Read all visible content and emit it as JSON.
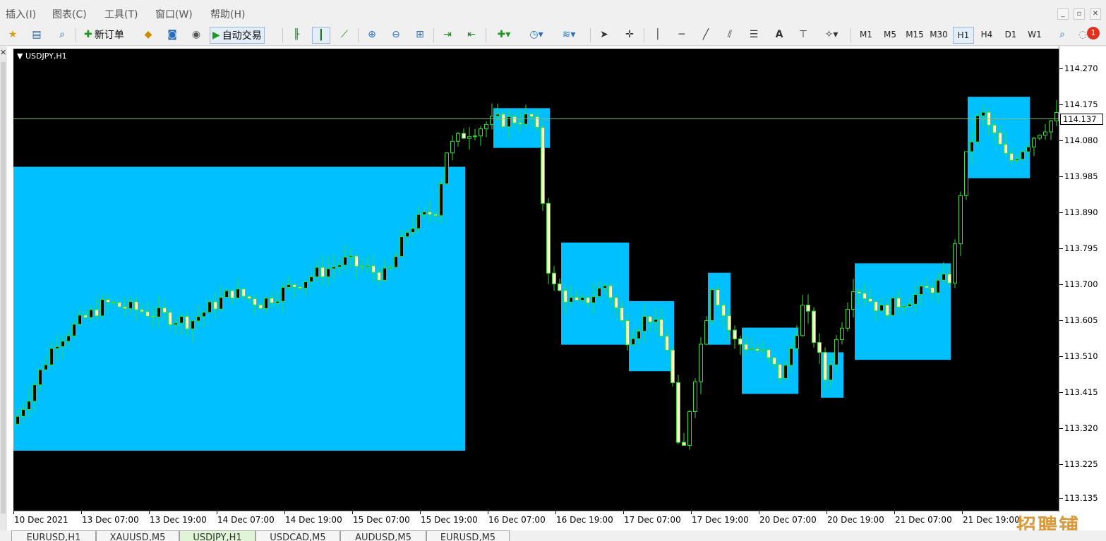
{
  "menu": {
    "items": [
      "插入(I)",
      "图表(C)",
      "工具(T)",
      "窗口(W)",
      "帮助(H)"
    ],
    "window_controls": [
      "_",
      "▫",
      "✕"
    ]
  },
  "toolbar": {
    "new_order_label": "新订单",
    "auto_trade_label": "自动交易",
    "text_tool_label": "A",
    "timeframes": [
      "M1",
      "M5",
      "M15",
      "M30",
      "H1",
      "H4",
      "D1",
      "W1"
    ],
    "active_timeframe": "H1",
    "notification_count": "1"
  },
  "chart": {
    "symbol_label": "USDJPY,H1",
    "current_price": "114.137",
    "price_ticks": [
      "114.270",
      "114.175",
      "114.080",
      "113.985",
      "113.890",
      "113.795",
      "113.700",
      "113.605",
      "113.510",
      "113.415",
      "113.320",
      "113.225",
      "113.135"
    ],
    "time_ticks": [
      "10 Dec 2021",
      "13 Dec 07:00",
      "13 Dec 19:00",
      "14 Dec 07:00",
      "14 Dec 19:00",
      "15 Dec 07:00",
      "15 Dec 19:00",
      "16 Dec 07:00",
      "16 Dec 19:00",
      "17 Dec 07:00",
      "17 Dec 19:00",
      "20 Dec 07:00",
      "20 Dec 19:00",
      "21 Dec 07:00",
      "21 Dec 19:00"
    ],
    "colors": {
      "background": "#000000",
      "bull_candle": "#000000",
      "bear_candle": "#ffffcc",
      "wick": "#33dd33",
      "box_fill": "#00c0ff",
      "price_line": "#7fbf7f"
    }
  },
  "chart_data": {
    "type": "candlestick",
    "title": "USDJPY,H1",
    "ylim": [
      113.135,
      114.27
    ],
    "current_price": 114.137,
    "range_boxes": [
      {
        "from": "10 Dec 2021",
        "to": "15 Dec 19:00",
        "high": 114.01,
        "low": 113.26
      },
      {
        "from": "16 Dec 00:00",
        "to": "16 Dec 10:00",
        "high": 114.165,
        "low": 114.06
      },
      {
        "from": "16 Dec 12:00",
        "to": "17 Dec 00:00",
        "high": 113.81,
        "low": 113.54
      },
      {
        "from": "17 Dec 00:00",
        "to": "17 Dec 08:00",
        "high": 113.655,
        "low": 113.47
      },
      {
        "from": "17 Dec 14:00",
        "to": "17 Dec 18:00",
        "high": 113.73,
        "low": 113.54
      },
      {
        "from": "17 Dec 20:00",
        "to": "20 Dec 06:00",
        "high": 113.585,
        "low": 113.41
      },
      {
        "from": "20 Dec 10:00",
        "to": "20 Dec 14:00",
        "high": 113.52,
        "low": 113.4
      },
      {
        "from": "20 Dec 16:00",
        "to": "21 Dec 09:00",
        "high": 113.755,
        "low": 113.5
      },
      {
        "from": "21 Dec 12:00",
        "to": "21 Dec 23:00",
        "high": 114.195,
        "low": 113.98
      }
    ]
  },
  "tabs": {
    "items": [
      "EURUSD,H1",
      "XAUUSD,M5",
      "USDJPY,H1",
      "USDCAD,M5",
      "AUDUSD,M5",
      "EURUSD,M5"
    ],
    "active": "USDJPY,H1"
  },
  "watermark": "招聘铺"
}
